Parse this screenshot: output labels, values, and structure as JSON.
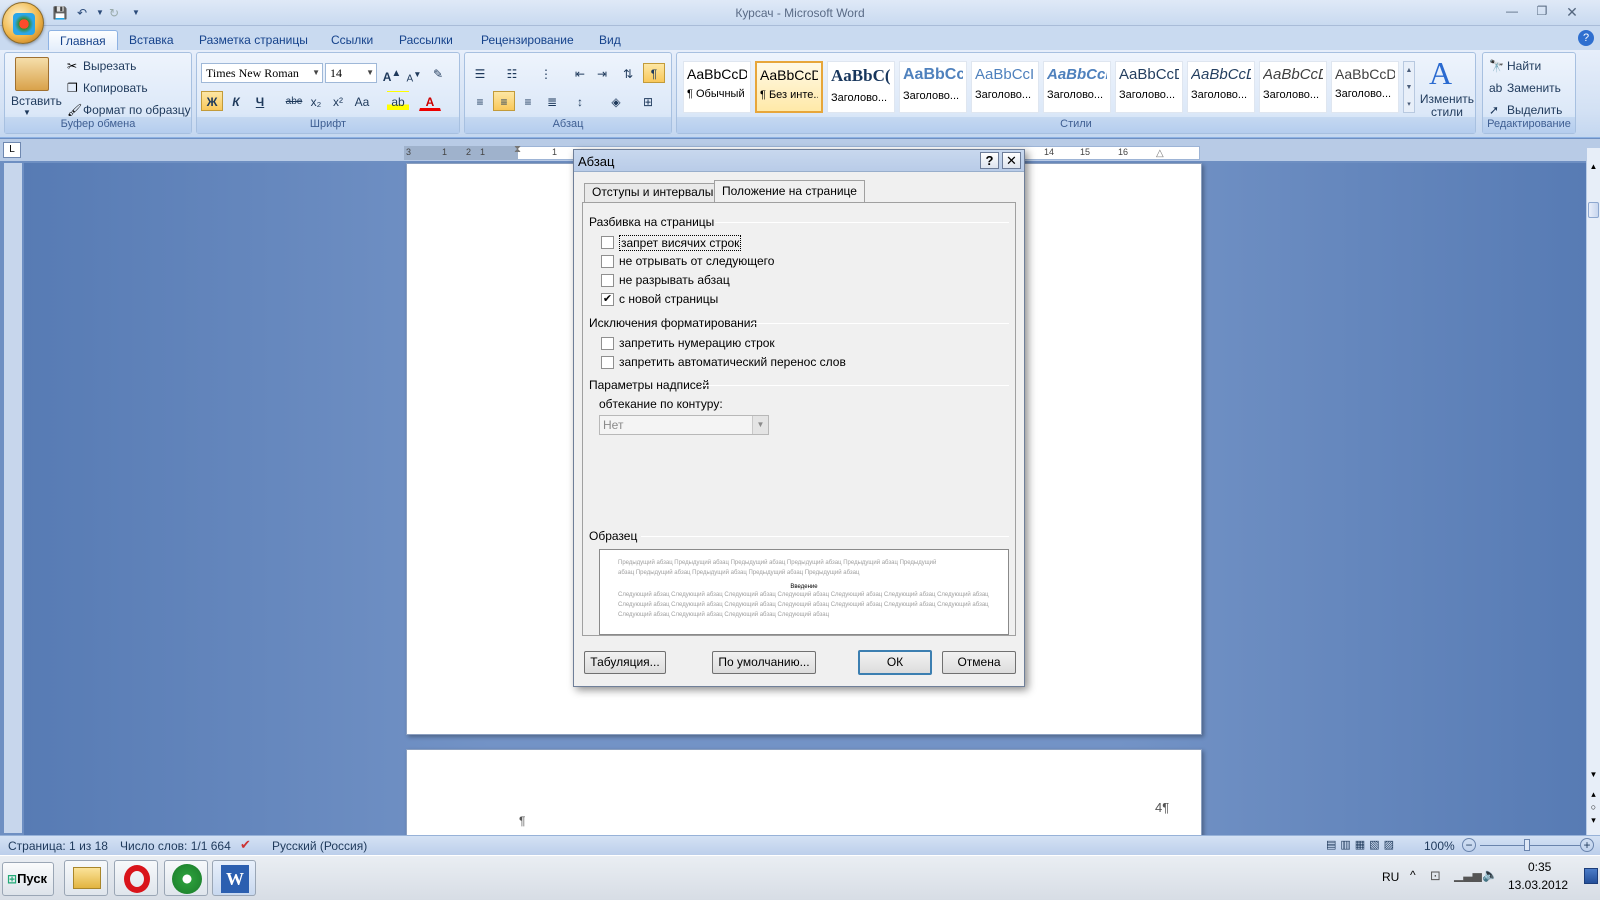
{
  "window": {
    "title": "Курсач - Microsoft Word"
  },
  "ribbon_tabs": [
    "Главная",
    "Вставка",
    "Разметка страницы",
    "Ссылки",
    "Рассылки",
    "Рецензирование",
    "Вид"
  ],
  "clipboard": {
    "paste": "Вставить",
    "cut": "Вырезать",
    "copy": "Копировать",
    "format_painter": "Формат по образцу",
    "label": "Буфер обмена"
  },
  "font": {
    "name": "Times New Roman",
    "size": "14",
    "label": "Шрифт",
    "bold": "Ж",
    "italic": "К",
    "underline": "Ч",
    "strike": "abe",
    "sub": "x₂",
    "sup": "x²",
    "case": "Aa"
  },
  "paragraph": {
    "label": "Абзац"
  },
  "styles": {
    "label": "Стили",
    "items": [
      {
        "sample": "AaBbCcDc",
        "name": "¶ Обычный"
      },
      {
        "sample": "AaBbCcDc",
        "name": "¶ Без инте..."
      },
      {
        "sample": "AaBbC(",
        "name": "Заголово..."
      },
      {
        "sample": "AaBbCc",
        "name": "Заголово..."
      },
      {
        "sample": "AaBbCcI",
        "name": "Заголово..."
      },
      {
        "sample": "AaBbCcD",
        "name": "Заголово..."
      },
      {
        "sample": "AaBbCcD",
        "name": "Заголово..."
      },
      {
        "sample": "AaBbCcD",
        "name": "Заголово..."
      },
      {
        "sample": "AaBbCcD",
        "name": "Заголово..."
      },
      {
        "sample": "AaBbCcDd",
        "name": "Заголово..."
      }
    ],
    "change_styles": "Изменить стили"
  },
  "editing": {
    "label": "Редактирование",
    "find": "Найти",
    "replace": "Заменить",
    "select": "Выделить"
  },
  "ruler": {
    "marks": [
      "3",
      "1",
      "2",
      "1",
      "1",
      "1",
      "14",
      "15",
      "16"
    ]
  },
  "dialog": {
    "title": "Абзац",
    "help": "?",
    "tabs": [
      "Отступы и интервалы",
      "Положение на странице"
    ],
    "active_tab": 1,
    "section_pagination": "Разбивка на страницы",
    "pagination_options": [
      {
        "label": "запрет висячих строк",
        "checked": false
      },
      {
        "label": "не отрывать от следующего",
        "checked": false
      },
      {
        "label": "не разрывать абзац",
        "checked": false
      },
      {
        "label": "с новой страницы",
        "checked": true
      }
    ],
    "section_exceptions": "Исключения форматирования",
    "exception_options": [
      {
        "label": "запретить нумерацию строк",
        "checked": false
      },
      {
        "label": "запретить автоматический перенос слов",
        "checked": false
      }
    ],
    "section_textbox": "Параметры надписей",
    "wrap_label": "обтекание по контуру:",
    "wrap_value": "Нет",
    "section_preview": "Образец",
    "preview_prev": "Предыдущий абзац Предыдущий абзац Предыдущий абзац Предыдущий абзац Предыдущий абзац",
    "preview_center": "Введение",
    "preview_next": "Следующий абзац Следующий абзац Следующий абзац Следующий абзац Следующий абзац Следующий абзац",
    "btn_tabs": "Табуляция...",
    "btn_default": "По умолчанию...",
    "btn_ok": "ОК",
    "btn_cancel": "Отмена"
  },
  "document": {
    "page_number": "4¶",
    "pilcrow": "¶"
  },
  "status": {
    "page": "Страница: 1 из 18",
    "words": "Число слов: 1/1 664",
    "language": "Русский (Россия)",
    "zoom": "100%"
  },
  "taskbar": {
    "start": "Пуск",
    "lang": "RU",
    "time": "0:35",
    "date": "13.03.2012"
  }
}
